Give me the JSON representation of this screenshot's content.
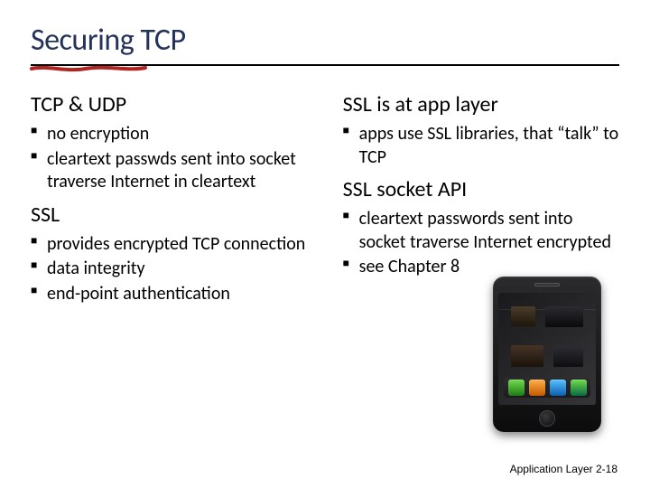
{
  "title": "Securing TCP",
  "left": {
    "h1": "TCP & UDP",
    "bullets1": [
      "no encryption",
      "cleartext passwds sent into socket traverse Internet  in cleartext"
    ],
    "h2": "SSL",
    "bullets2": [
      "provides encrypted TCP connection",
      "data integrity",
      "end-point authentication"
    ]
  },
  "right": {
    "h1": "SSL is at app layer",
    "bullets1": [
      " apps use SSL libraries, that “talk” to TCP"
    ],
    "h2": "SSL socket API",
    "bullets2": [
      "cleartext passwords sent into socket traverse Internet encrypted",
      "see Chapter 8"
    ]
  },
  "footer": {
    "label": "Application Layer",
    "page": "2-18"
  }
}
